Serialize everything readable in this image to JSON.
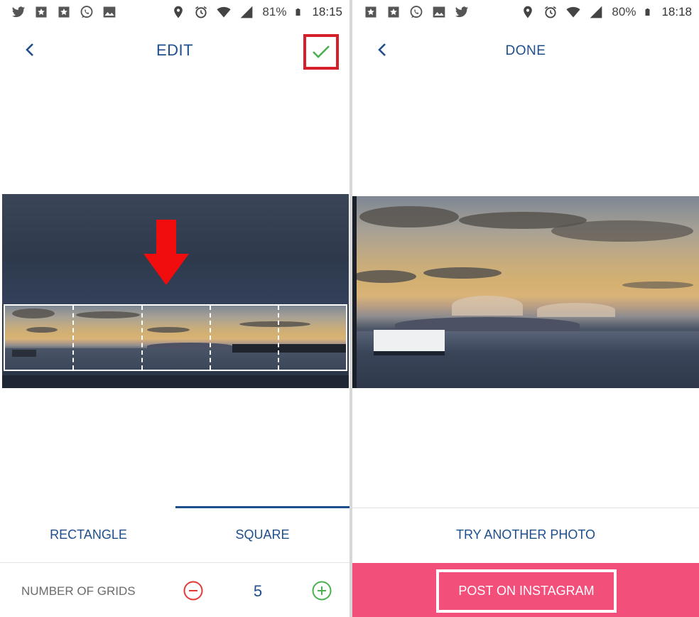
{
  "left": {
    "status": {
      "battery": "81%",
      "time": "18:15"
    },
    "header": {
      "title": "EDIT"
    },
    "tabs": {
      "rectangle": "RECTANGLE",
      "square": "SQUARE"
    },
    "grids": {
      "label": "NUMBER OF GRIDS",
      "count": "5"
    }
  },
  "right": {
    "status": {
      "battery": "80%",
      "time": "18:18"
    },
    "header": {
      "title": "DONE"
    },
    "try_label": "TRY ANOTHER PHOTO",
    "post_label": "POST ON INSTAGRAM"
  },
  "colors": {
    "accent": "#1d4f8c",
    "highlight": "#d5202b",
    "instagram_bar": "#f24f7b",
    "check": "#4caf50",
    "minus": "#e53935"
  },
  "icons": {
    "status_left_a": [
      "twitter-icon",
      "star-icon",
      "star-icon",
      "whatsapp-icon",
      "image-icon"
    ],
    "status_left_b": [
      "star-icon",
      "star-icon",
      "whatsapp-icon",
      "image-icon",
      "twitter-icon"
    ],
    "status_right": [
      "location-icon",
      "alarm-icon",
      "wifi-icon",
      "signal-icon",
      "battery-icon"
    ]
  }
}
